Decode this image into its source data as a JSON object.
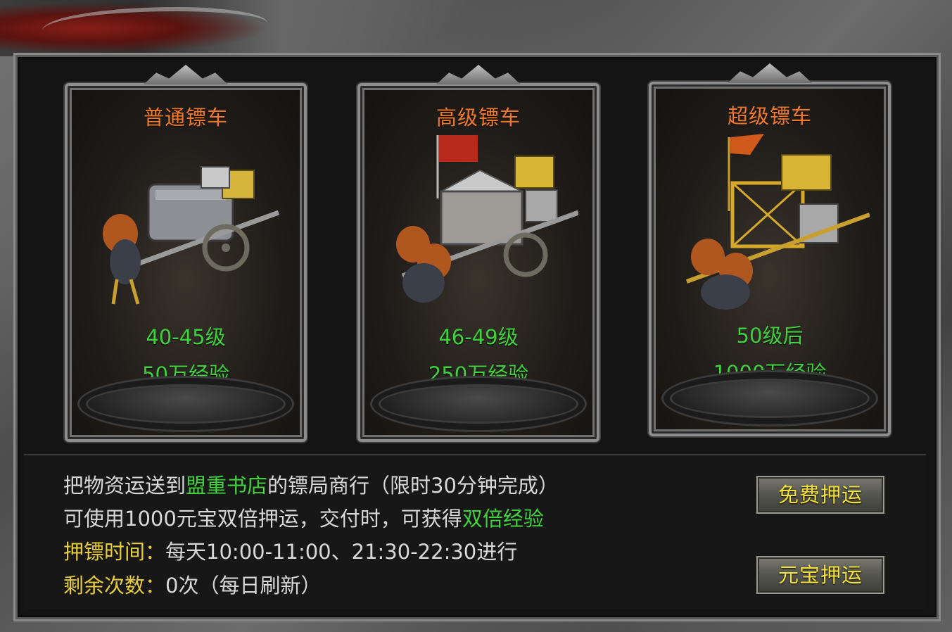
{
  "carts": [
    {
      "title": "普通镖车",
      "level": "40-45级",
      "exp": "50万经验",
      "variant": "normal"
    },
    {
      "title": "高级镖车",
      "level": "46-49级",
      "exp": "250万经验",
      "variant": "advanced"
    },
    {
      "title": "超级镖车",
      "level": "50级后",
      "exp": "1000万经验",
      "variant": "super"
    }
  ],
  "info": {
    "line1_pre": "把物资运送到",
    "line1_place": "盟重书店",
    "line1_post": "的镖局商行（限时30分钟完成）",
    "line2_pre": "可使用1000元宝双倍押运，交付时，可获得",
    "line2_highlight": "双倍经验",
    "time_label": "押镖时间：",
    "time_value": "每天10:00-11:00、21:30-22:30进行",
    "remain_label": "剩余次数：",
    "remain_value": "0次（每日刷新）"
  },
  "buttons": {
    "free": "免费押运",
    "yuanbao": "元宝押运"
  },
  "colors": {
    "title_orange": "#f07a2a",
    "green": "#3fd23c",
    "yellow": "#e8cf3a",
    "button_text": "#f3e03a"
  }
}
